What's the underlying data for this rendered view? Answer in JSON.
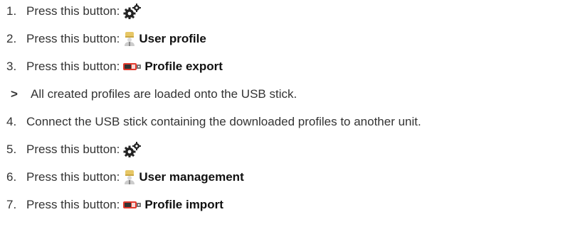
{
  "steps": [
    {
      "num": "1.",
      "text": "Press this button:",
      "button": {
        "icon": "gear-icon",
        "label": ""
      }
    },
    {
      "num": "2.",
      "text": "Press this button:",
      "button": {
        "icon": "user-chef-icon",
        "label": "User profile"
      }
    },
    {
      "num": "3.",
      "text": "Press this button:",
      "button": {
        "icon": "usb-stick-icon",
        "label": "Profile export"
      }
    },
    {
      "marker": ">",
      "text": "All created profiles are loaded onto the USB stick."
    },
    {
      "num": "4.",
      "text": "Connect the USB stick containing the downloaded profiles to another unit."
    },
    {
      "num": "5.",
      "text": "Press this button:",
      "button": {
        "icon": "gear-icon",
        "label": ""
      }
    },
    {
      "num": "6.",
      "text": "Press this button:",
      "button": {
        "icon": "user-chef-icon",
        "label": "User management"
      }
    },
    {
      "num": "7.",
      "text": "Press this button:",
      "button": {
        "icon": "usb-stick-icon",
        "label": "Profile import"
      }
    }
  ],
  "colors": {
    "text": "#333333",
    "gear": "#222222",
    "chef_hat": "#e7c766",
    "usb_body": "#e23a2e"
  }
}
